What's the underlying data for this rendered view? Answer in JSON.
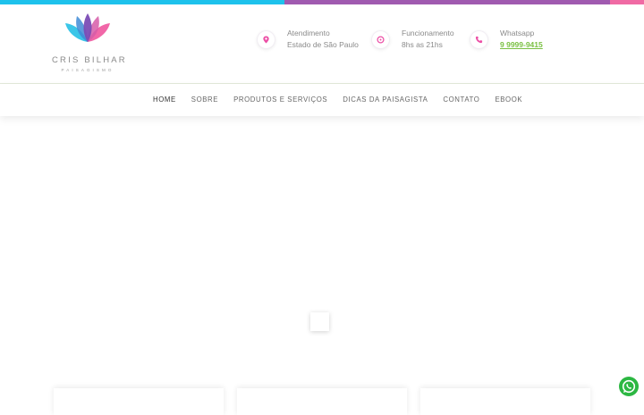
{
  "colors": {
    "top_bar": [
      "#1ec2ec",
      "#a05ab0",
      "#f06aa4"
    ],
    "accent_pink": "#ec4fa6",
    "link_green": "#7ac043",
    "whatsapp_green": "#2cb742"
  },
  "logo": {
    "name": "CRIS BILHAR",
    "tagline": "PAISAGISMO",
    "icon": "lotus-icon"
  },
  "contact_info": [
    {
      "icon": "map-pin-icon",
      "title": "Atendimento",
      "detail": "Estado de São Paulo"
    },
    {
      "icon": "clock-icon",
      "title": "Funcionamento",
      "detail": "8hs as 21hs"
    },
    {
      "icon": "phone-icon",
      "title": "Whatsapp",
      "detail": "9 9999-9415"
    }
  ],
  "nav": {
    "items": [
      "HOME",
      "SOBRE",
      "PRODUTOS E SERVIÇOS",
      "DICAS DA PAISAGISTA",
      "CONTATO",
      "EBOOK"
    ],
    "active": "HOME"
  },
  "floating": {
    "icon": "whatsapp-icon"
  }
}
